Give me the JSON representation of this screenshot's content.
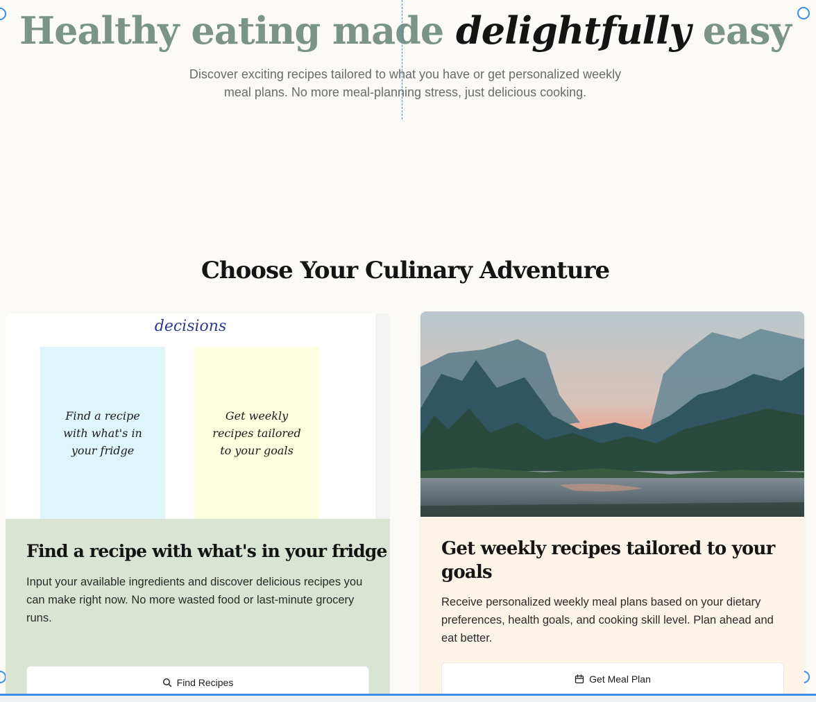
{
  "hero": {
    "title_main": "Healthy eating made ",
    "title_accent": "delightfully",
    "title_end": " easy",
    "subtitle": "Discover exciting recipes tailored to what you have or get personalized weekly meal plans. No more meal-planning stress, just delicious cooking."
  },
  "section": {
    "title": "Choose Your Culinary Adventure"
  },
  "cards": {
    "recipe": {
      "doodle_top": "decisions",
      "doodle_box_1": "Find a recipe with what's in your fridge",
      "doodle_box_2": "Get weekly recipes tailored to your goals",
      "title": "Find a recipe with what's in your fridge",
      "description": "Input your available ingredients and discover delicious recipes you can make right now. No more wasted food or last-minute grocery runs.",
      "button_label": "Find Recipes",
      "button_icon": "search-icon",
      "background": "#d9e4d2"
    },
    "meal_plan": {
      "image": "mountain-lake-landscape",
      "title": "Get weekly recipes tailored to your goals",
      "description": "Receive personalized weekly meal plans based on your dietary preferences, health goals, and cooking skill level. Plan ahead and eat better.",
      "button_label": "Get Meal Plan",
      "button_icon": "calendar-icon",
      "background": "#fdf4e8"
    }
  },
  "colors": {
    "title_green": "#7a9488",
    "selection_blue": "#3b8ee6",
    "page_bg": "#fbfaf6"
  }
}
